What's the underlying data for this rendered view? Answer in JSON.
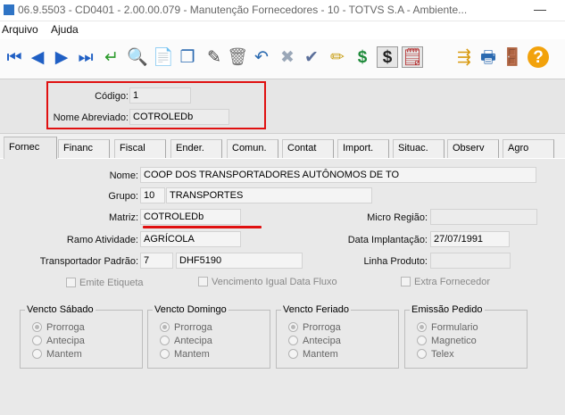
{
  "window": {
    "title": "06.9.5503 - CD0401 - 2.00.00.079 - Manutenção Fornecedores - 10 - TOTVS S.A - Ambiente..."
  },
  "menu": {
    "items": [
      "Arquivo",
      "Ajuda"
    ]
  },
  "toolbar": {
    "buttons": [
      {
        "icon": "first-record-icon",
        "glyph": "⏮",
        "color": "#1f5fc4"
      },
      {
        "icon": "previous-record-icon",
        "glyph": "◀",
        "color": "#1f5fc4"
      },
      {
        "icon": "next-record-icon",
        "glyph": "▶",
        "color": "#1f5fc4"
      },
      {
        "icon": "last-record-icon",
        "glyph": "⏭",
        "color": "#1f5fc4"
      },
      {
        "icon": "go-to-icon",
        "glyph": "↵",
        "color": "#2a9a2a"
      },
      {
        "icon": "search-icon",
        "glyph": "🔍",
        "color": "#1e5b99"
      },
      {
        "icon": "new-record-icon",
        "glyph": "📄",
        "color": "#3a9a3a"
      },
      {
        "icon": "copy-icon",
        "glyph": "❐",
        "color": "#2b6ab0"
      },
      {
        "icon": "edit-icon",
        "glyph": "✎",
        "color": "#444"
      },
      {
        "icon": "delete-icon",
        "glyph": "🗑",
        "color": "#777"
      },
      {
        "icon": "undo-icon",
        "glyph": "↶",
        "color": "#2b6ab0"
      },
      {
        "icon": "cancel-icon",
        "glyph": "✖",
        "color": "#9aa7b8"
      },
      {
        "icon": "confirm-icon",
        "glyph": "✔",
        "color": "#5b6f9a"
      },
      {
        "icon": "pencil-icon",
        "glyph": "✏",
        "color": "#c9a019"
      },
      {
        "icon": "dollar-icon",
        "glyph": "$",
        "color": "#1e8a3a"
      },
      {
        "icon": "dollar-list-icon",
        "glyph": "$",
        "color": "#222"
      },
      {
        "icon": "report-icon",
        "glyph": "🗒",
        "color": "#b02020"
      },
      {
        "icon": "hierarchy-icon",
        "glyph": "⇶",
        "color": "#d89a10"
      },
      {
        "icon": "print-icon",
        "glyph": "🖶",
        "color": "#2b6ab0"
      },
      {
        "icon": "exit-icon",
        "glyph": "🚪",
        "color": "#444"
      },
      {
        "icon": "help-icon",
        "glyph": "?",
        "color": "#fff"
      }
    ]
  },
  "header": {
    "codigo_label": "Código:",
    "codigo_value": "1",
    "nome_abreviado_label": "Nome Abreviado:",
    "nome_abreviado_value": "COTROLEDb"
  },
  "tabs": [
    "Fornec",
    "Financ",
    "Fiscal",
    "Ender.",
    "Comun.",
    "Contat",
    "Import.",
    "Situac.",
    "Observ",
    "Agro"
  ],
  "form": {
    "nome_label": "Nome:",
    "nome_value": "COOP DOS TRANSPORTADORES AUTÔNOMOS DE TO",
    "grupo_label": "Grupo:",
    "grupo_code": "10",
    "grupo_desc": "TRANSPORTES",
    "matriz_label": "Matriz:",
    "matriz_value": "COTROLEDb",
    "micro_regiao_label": "Micro Região:",
    "micro_regiao_value": "",
    "ramo_label": "Ramo Atividade:",
    "ramo_value": "AGRÍCOLA",
    "data_impl_label": "Data Implantação:",
    "data_impl_value": "27/07/1991",
    "transp_label": "Transportador Padrão:",
    "transp_code": "7",
    "transp_desc": "DHF5190",
    "linha_label": "Linha Produto:",
    "linha_value": "",
    "emite_etiqueta": "Emite Etiqueta",
    "venc_igual": "Vencimento Igual Data Fluxo",
    "extra_fornecedor": "Extra Fornecedor"
  },
  "groups": [
    {
      "title": "Vencto Sábado",
      "options": [
        "Prorroga",
        "Antecipa",
        "Mantem"
      ],
      "selected": 0
    },
    {
      "title": "Vencto Domingo",
      "options": [
        "Prorroga",
        "Antecipa",
        "Mantem"
      ],
      "selected": 0
    },
    {
      "title": "Vencto Feriado",
      "options": [
        "Prorroga",
        "Antecipa",
        "Mantem"
      ],
      "selected": 0
    },
    {
      "title": "Emissão Pedido",
      "options": [
        "Formulario",
        "Magnetico",
        "Telex"
      ],
      "selected": 0
    }
  ],
  "colors": {
    "accent_red": "#e01010",
    "nav_blue": "#1f5fc4"
  }
}
